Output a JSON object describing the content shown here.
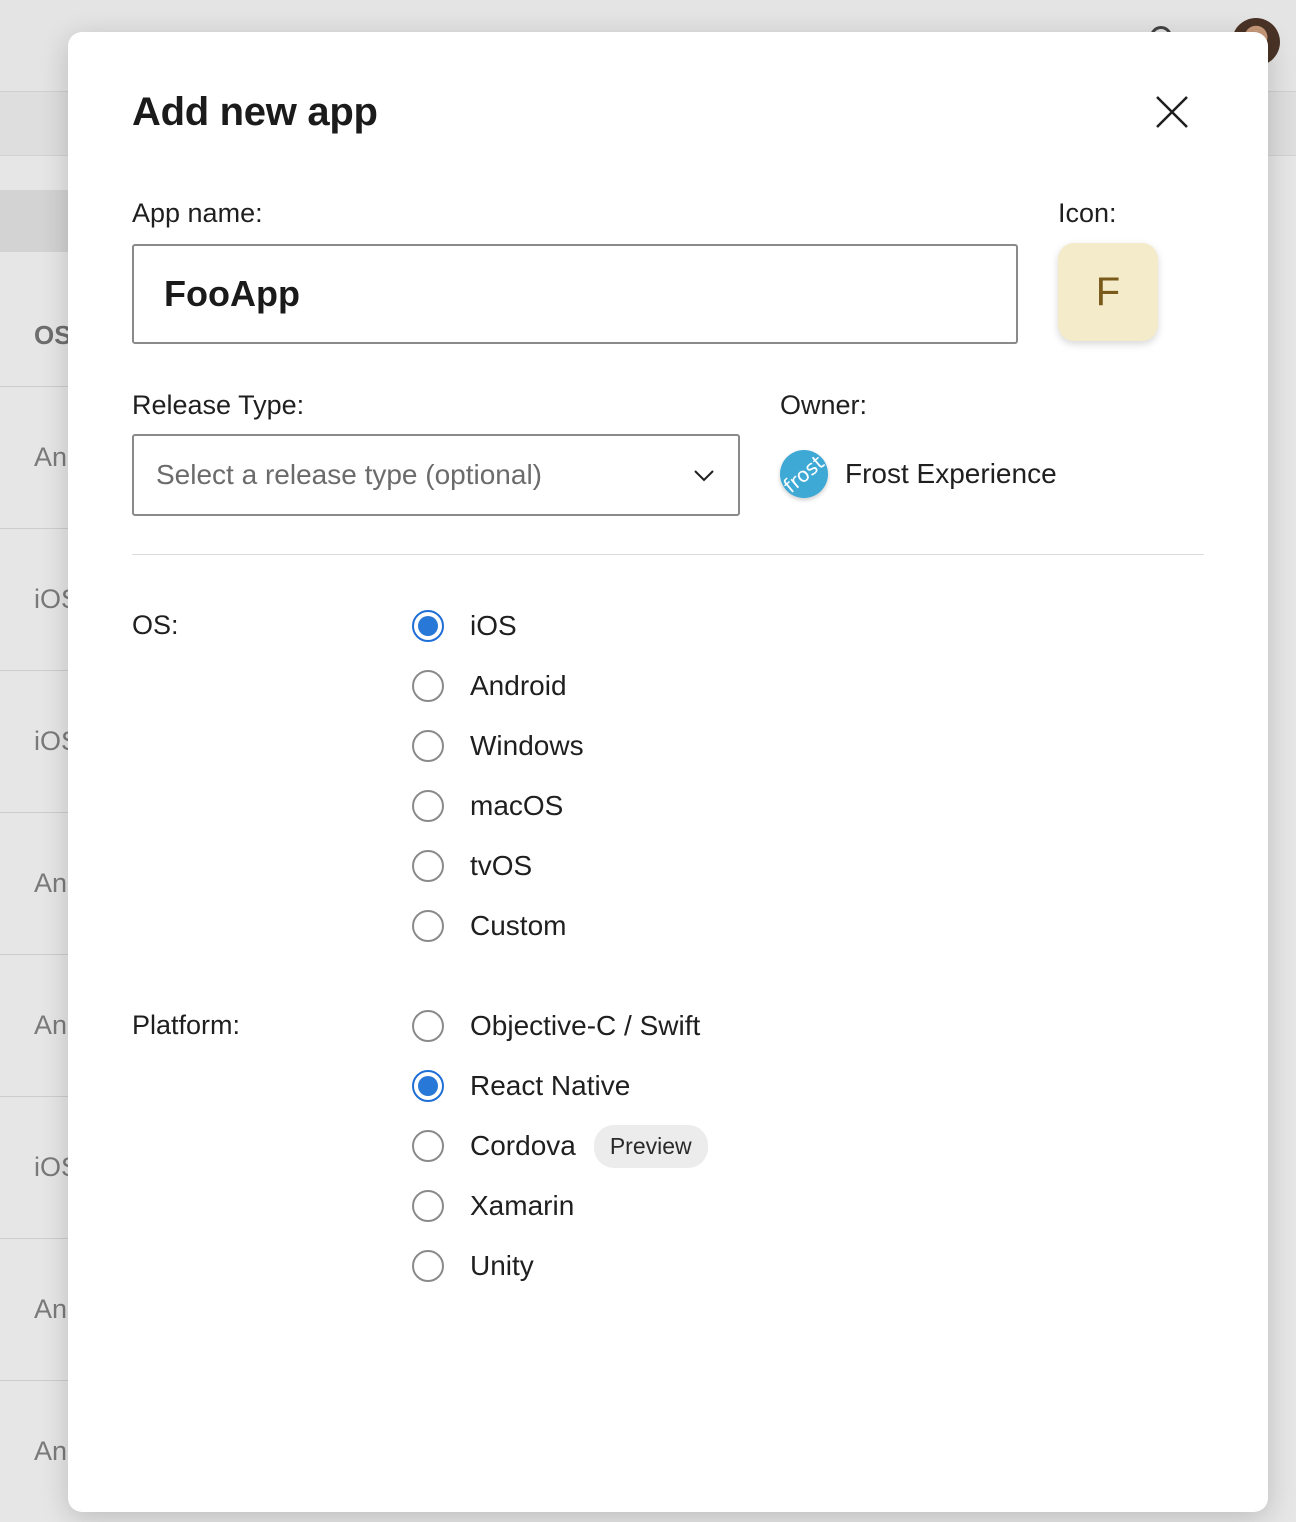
{
  "background": {
    "column_header": "OS",
    "rows": [
      "An",
      "iOS",
      "iOS",
      "An",
      "An",
      "iOS",
      "An",
      "An"
    ]
  },
  "modal": {
    "title": "Add new app",
    "close_icon": "close-icon",
    "app_name_label": "App name:",
    "app_name_value": "FooApp",
    "icon_label": "Icon:",
    "icon_letter": "F",
    "release_type_label": "Release Type:",
    "release_type_placeholder": "Select a release type (optional)",
    "owner_label": "Owner:",
    "owner_logo_text": "frost",
    "owner_name": "Frost Experience",
    "os_label": "OS:",
    "os_options": [
      {
        "label": "iOS",
        "checked": true
      },
      {
        "label": "Android",
        "checked": false
      },
      {
        "label": "Windows",
        "checked": false
      },
      {
        "label": "macOS",
        "checked": false
      },
      {
        "label": "tvOS",
        "checked": false
      },
      {
        "label": "Custom",
        "checked": false
      }
    ],
    "platform_label": "Platform:",
    "platform_options": [
      {
        "label": "Objective-C / Swift",
        "checked": false
      },
      {
        "label": "React Native",
        "checked": true
      },
      {
        "label": "Cordova",
        "checked": false,
        "badge": "Preview"
      },
      {
        "label": "Xamarin",
        "checked": false
      },
      {
        "label": "Unity",
        "checked": false
      }
    ]
  },
  "colors": {
    "accent": "#2878d8",
    "icon_tile": "#f4ebcb",
    "owner_logo": "#3fa9d6"
  }
}
